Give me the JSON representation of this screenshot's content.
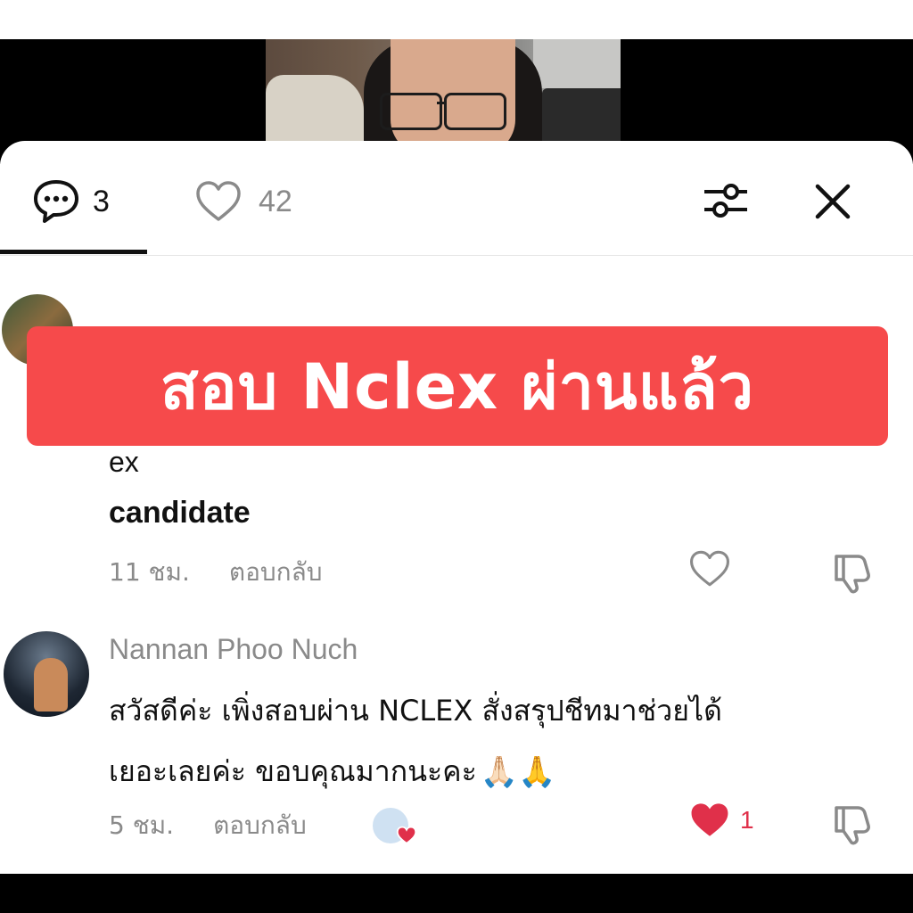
{
  "tabs": {
    "comments_count": "3",
    "likes_count": "42"
  },
  "overlay": {
    "banner_text": "สอบ Nclex ผ่านแล้ว"
  },
  "comments": [
    {
      "text_line1": "ex",
      "text_line2": "candidate",
      "time": "11 ชม.",
      "reply_label": "ตอบกลับ"
    },
    {
      "author": "Nannan Phoo Nuch",
      "text_line1": "สวัสดีค่ะ เพิ่งสอบผ่าน NCLEX สั่งสรุปชีทมาช่วยได้",
      "text_line2": "เยอะเลยค่ะ ขอบคุณมากนะคะ",
      "emoji": "🙏🏻🙏",
      "time": "5 ชม.",
      "reply_label": "ตอบกลับ",
      "like_count": "1"
    }
  ],
  "colors": {
    "banner": "#f64a4b",
    "liked_heart": "#e0304a",
    "muted": "#8a8a8a"
  },
  "icons": [
    "comment-bubble-icon",
    "heart-outline-icon",
    "filter-sliders-icon",
    "close-icon",
    "thumbs-down-icon",
    "heart-filled-icon"
  ]
}
